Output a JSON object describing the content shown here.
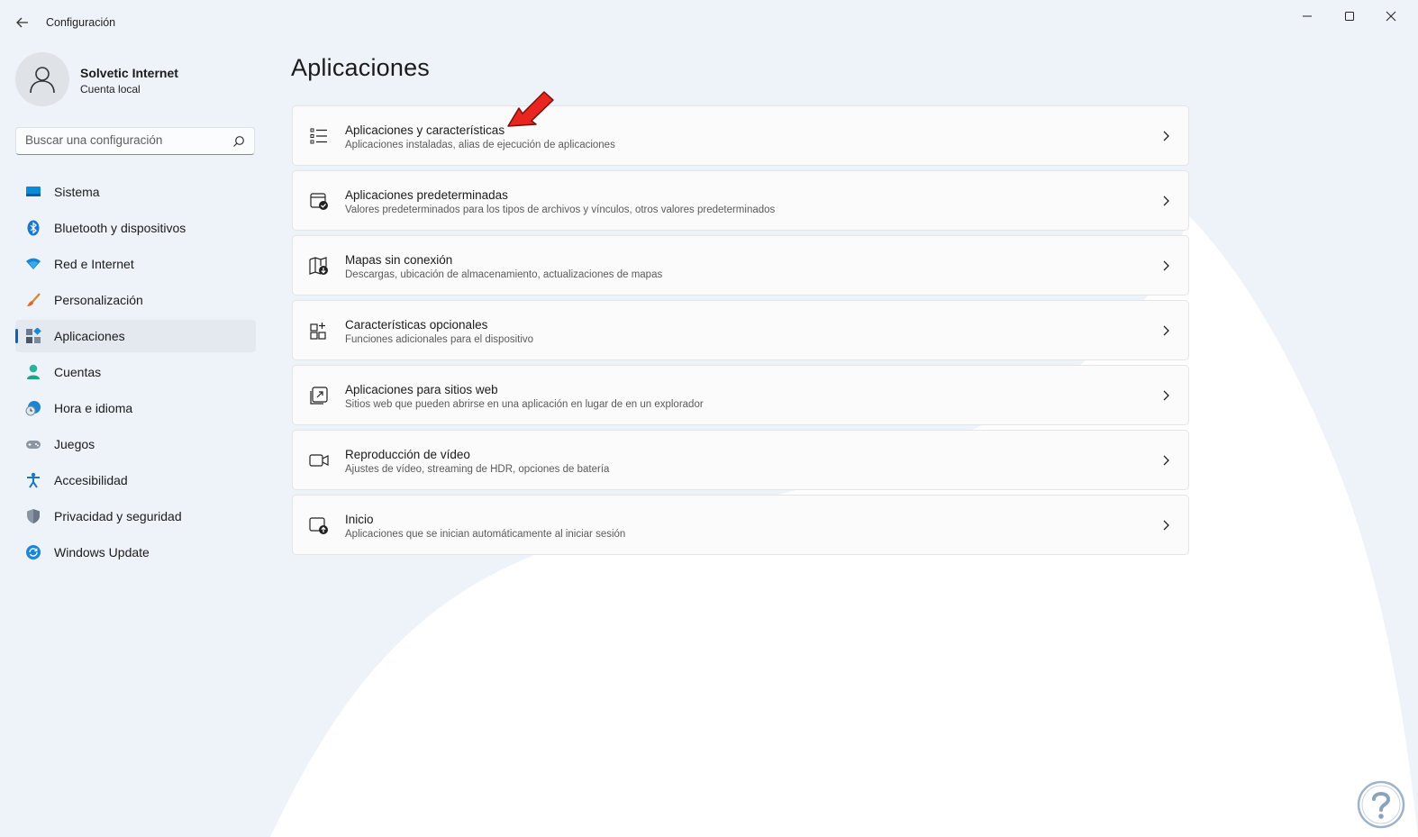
{
  "window": {
    "title": "Configuración",
    "controls": [
      "minimize",
      "maximize",
      "close"
    ]
  },
  "user": {
    "name": "Solvetic Internet",
    "account_type": "Cuenta local"
  },
  "search": {
    "placeholder": "Buscar una configuración"
  },
  "sidebar": {
    "items": [
      {
        "label": "Sistema",
        "icon": "system-icon",
        "active": false
      },
      {
        "label": "Bluetooth y dispositivos",
        "icon": "bluetooth-icon",
        "active": false
      },
      {
        "label": "Red e Internet",
        "icon": "wifi-icon",
        "active": false
      },
      {
        "label": "Personalización",
        "icon": "brush-icon",
        "active": false
      },
      {
        "label": "Aplicaciones",
        "icon": "apps-icon",
        "active": true
      },
      {
        "label": "Cuentas",
        "icon": "person-icon",
        "active": false
      },
      {
        "label": "Hora e idioma",
        "icon": "clock-globe-icon",
        "active": false
      },
      {
        "label": "Juegos",
        "icon": "gamepad-icon",
        "active": false
      },
      {
        "label": "Accesibilidad",
        "icon": "accessibility-icon",
        "active": false
      },
      {
        "label": "Privacidad y seguridad",
        "icon": "shield-icon",
        "active": false
      },
      {
        "label": "Windows Update",
        "icon": "update-icon",
        "active": false
      }
    ]
  },
  "main": {
    "title": "Aplicaciones",
    "cards": [
      {
        "title": "Aplicaciones y características",
        "desc": "Aplicaciones instaladas, alias de ejecución de aplicaciones",
        "icon": "list-icon"
      },
      {
        "title": "Aplicaciones predeterminadas",
        "desc": "Valores predeterminados para los tipos de archivos y vínculos, otros valores predeterminados",
        "icon": "default-apps-icon"
      },
      {
        "title": "Mapas sin conexión",
        "desc": "Descargas, ubicación de almacenamiento, actualizaciones de mapas",
        "icon": "map-download-icon"
      },
      {
        "title": "Características opcionales",
        "desc": "Funciones adicionales para el dispositivo",
        "icon": "optional-features-icon"
      },
      {
        "title": "Aplicaciones para sitios web",
        "desc": "Sitios web que pueden abrirse en una aplicación en lugar de en un explorador",
        "icon": "web-apps-icon"
      },
      {
        "title": "Reproducción de vídeo",
        "desc": "Ajustes de vídeo, streaming de HDR, opciones de batería",
        "icon": "video-icon"
      },
      {
        "title": "Inicio",
        "desc": "Aplicaciones que se inician automáticamente al iniciar sesión",
        "icon": "startup-icon"
      }
    ]
  },
  "colors": {
    "accent": "#0067c0",
    "background": "#eef3f9",
    "card": "#fbfbfb",
    "annotation_arrow": "#e8251f"
  }
}
